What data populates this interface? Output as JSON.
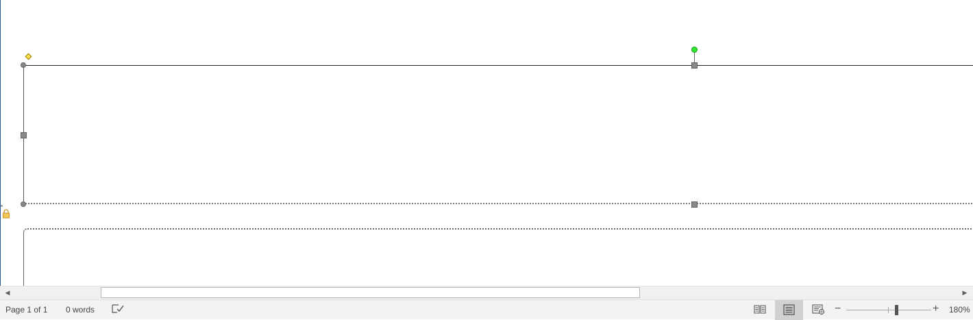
{
  "statusbar": {
    "page_info": "Page 1 of 1",
    "word_count": "0 words",
    "proofing_icon": "proofing-check-icon",
    "views": {
      "read_mode_icon": "read-mode-icon",
      "print_layout_icon": "print-layout-icon",
      "web_layout_icon": "web-layout-icon",
      "active": "print-layout"
    },
    "zoom": {
      "minus": "−",
      "plus": "+",
      "level": "180%"
    }
  },
  "scrollbar": {
    "left_arrow": "◀",
    "right_arrow": "▶"
  },
  "colors": {
    "rotation_handle": "#2ee82e",
    "adjust_handle": "#ffe24a",
    "accent_border": "#2b579a"
  }
}
